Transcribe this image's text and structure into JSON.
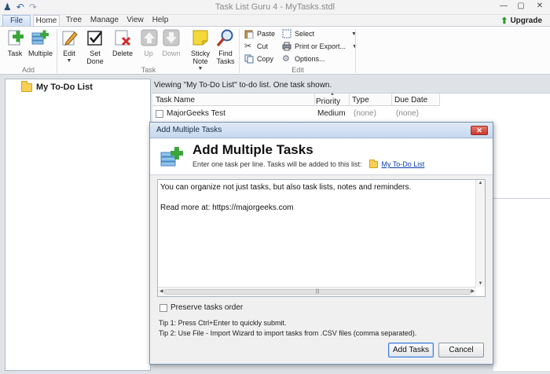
{
  "window": {
    "title": "Task List Guru 4 - MyTasks.stdl"
  },
  "qat": {
    "app_icon": "app-icon",
    "undo_icon": "undo-icon",
    "redo_icon": "redo-icon"
  },
  "tabs": {
    "file": "File",
    "home": "Home",
    "tree": "Tree",
    "manage": "Manage",
    "view": "View",
    "help": "Help"
  },
  "upgrade": "Upgrade",
  "ribbon": {
    "add_group": "Add",
    "task_group": "Task",
    "edit_group": "Edit",
    "task": "Task",
    "multiple": "Multiple",
    "edit": "Edit",
    "set": "Set",
    "done": "Done",
    "delete": "Delete",
    "up": "Up",
    "down": "Down",
    "sticky": "Sticky",
    "note": "Note",
    "find": "Find",
    "tasks": "Tasks",
    "paste": "Paste",
    "cut": "Cut",
    "copy": "Copy",
    "select": "Select",
    "print_export": "Print or Export...",
    "options": "Options..."
  },
  "tree": {
    "root_label": "My To-Do List"
  },
  "main": {
    "viewing_text": "Viewing \"My To-Do List\" to-do list. One task shown.",
    "columns": [
      "Task Name",
      "Priority",
      "Type",
      "Due Date"
    ],
    "rows": [
      {
        "name": "MajorGeeks Test",
        "priority": "Medium",
        "type": "(none)",
        "due": "(none)"
      }
    ]
  },
  "dialog": {
    "title": "Add Multiple Tasks",
    "heading": "Add Multiple Tasks",
    "subtitle": "Enter one task per line. Tasks will be added to this list:",
    "list_link": "My To-Do List",
    "text_content": "You can organize not just tasks, but also task lists, notes and reminders.\n\nRead more at: https://majorgeeks.com",
    "preserve_label": "Preserve tasks order",
    "tip1": "Tip 1: Press Ctrl+Enter to quickly submit.",
    "tip2": "Tip 2: Use File - Import Wizard to import tasks from .CSV files (comma separated).",
    "add_button": "Add Tasks",
    "cancel_button": "Cancel",
    "close_glyph": "✕"
  },
  "colors": {
    "accent_green": "#2e9b2e",
    "link_blue": "#0b3db0",
    "dialog_border": "#7e96b6"
  }
}
